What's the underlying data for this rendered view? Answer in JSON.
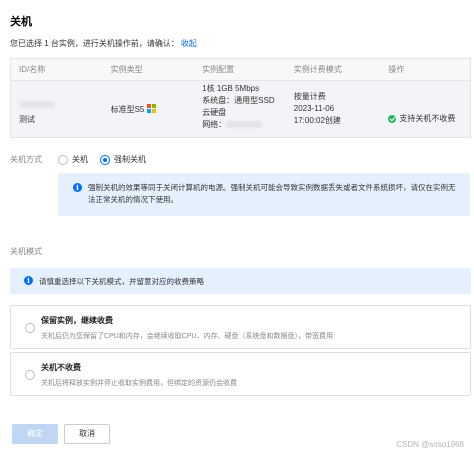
{
  "dialog": {
    "title": "关机",
    "confirm_text": "您已选择 1 台实例，进行关机操作前，请确认：",
    "collapse_link": "收起"
  },
  "table": {
    "headers": [
      "ID/名称",
      "实例类型",
      "实例配置",
      "实例计费模式",
      "操作"
    ],
    "row": {
      "name": "测试",
      "type": "标准型S5",
      "os_icon": "windows-icon",
      "config": {
        "line1": "1核 1GB 5Mbps",
        "line2": "系统盘：通用型SSD",
        "line3": "云硬盘",
        "line4_label": "网络："
      },
      "billing": {
        "mode": "按量计费",
        "date": "2023-11-06",
        "time": "17:00:02创建"
      },
      "op": "支持关机不收费"
    }
  },
  "method": {
    "label": "关机方式",
    "options": [
      "关机",
      "强制关机"
    ],
    "selected": "强制关机",
    "info": "强制关机的效果等同于关闭计算机的电源。强制关机可能会导致实例数据丢失或者文件系统损坏，请仅在实例无法正常关机的情况下使用。"
  },
  "mode": {
    "label": "关机模式",
    "notice": "请慎重选择以下关机模式，并留意对应的收费策略",
    "options": [
      {
        "title": "保留实例，继续收费",
        "desc": "关机后仍为您保留了CPU和内存，会继续收取CPU、内存、硬盘（系统盘和数据盘），带宽费用"
      },
      {
        "title": "关机不收费",
        "desc": "关机后将释放实例并停止收取实例费用，但绑定的资源仍会收费"
      }
    ]
  },
  "buttons": {
    "ok": "确定",
    "cancel": "取消"
  },
  "watermark": "CSDN @soso1968",
  "colors": {
    "accent": "#006eff",
    "success": "#29b560",
    "info_bg": "#e5f0ff"
  }
}
